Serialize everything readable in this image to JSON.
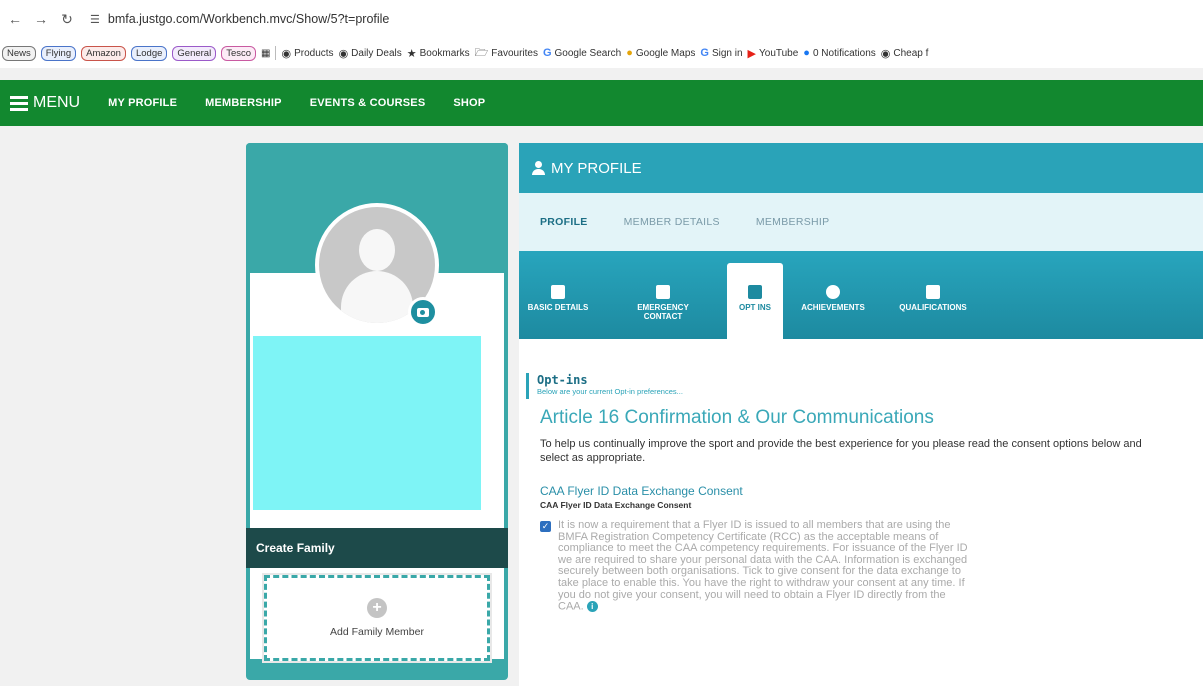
{
  "browser": {
    "url": "bmfa.justgo.com/Workbench.mvc/Show/5?t=profile",
    "tab_groups": [
      "News",
      "Flying",
      "Amazon",
      "Lodge",
      "General",
      "Tesco"
    ],
    "bookmarks": [
      "Products",
      "Daily Deals",
      "Bookmarks",
      "Favourites",
      "Google Search",
      "Google Maps",
      "Sign in",
      "YouTube",
      "0 Notifications",
      "Cheap f"
    ]
  },
  "site_nav": {
    "menu_label": "MENU",
    "links": [
      "MY PROFILE",
      "MEMBERSHIP",
      "EVENTS & COURSES",
      "SHOP"
    ]
  },
  "left_panel": {
    "create_family": "Create Family",
    "add_family_member": "Add Family Member"
  },
  "profile": {
    "header": "MY PROFILE",
    "main_tabs": [
      "PROFILE",
      "MEMBER DETAILS",
      "MEMBERSHIP"
    ],
    "active_main_tab": "PROFILE",
    "sub_tabs": [
      {
        "label": "BASIC DETAILS"
      },
      {
        "label": "EMERGENCY CONTACT"
      },
      {
        "label": "OPT INS"
      },
      {
        "label": "ACHIEVEMENTS"
      },
      {
        "label": "QUALIFICATIONS"
      }
    ],
    "active_sub_tab": "OPT INS"
  },
  "optins": {
    "title": "Opt-ins",
    "subtitle": "Below are your current Opt-in preferences...",
    "article_title": "Article 16 Confirmation & Our Communications",
    "intro": "To help us continually improve the sport and provide the best experience for you please read the consent options below and select as appropriate.",
    "caa_title": "CAA Flyer ID Data Exchange Consent",
    "caa_subtitle": "CAA Flyer ID Data Exchange Consent",
    "consent_checked": true,
    "consent_text": "It is now a requirement that a Flyer ID is issued to all members that are using the BMFA Registration Competency Certificate (RCC) as the acceptable means of compliance to meet the CAA competency requirements. For issuance of the Flyer ID we are required to share your personal data with the CAA. Information is exchanged securely between both organisations. Tick to give consent for the data exchange to take place to enable this. You have the right to withdraw your consent at any time. If you do not give your consent, you will need to obtain a Flyer ID directly from the CAA."
  },
  "colors": {
    "nav_green": "#12882f",
    "teal": "#2aa3b8",
    "cyan_block": "#7ef4f6",
    "dark_teal": "#1d4a4a"
  }
}
